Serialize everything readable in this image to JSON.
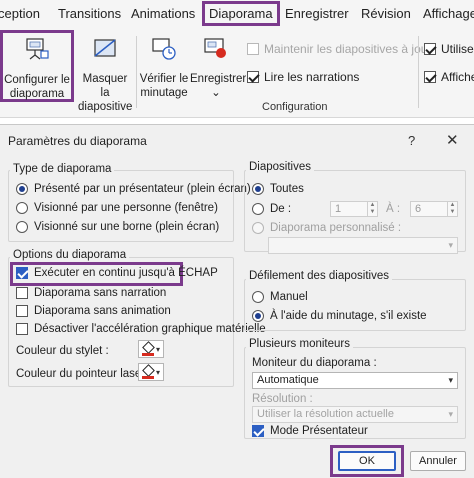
{
  "ribbon": {
    "tabs": [
      "ception",
      "Transitions",
      "Animations",
      "Diaporama",
      "Enregistrer",
      "Révision",
      "Affichage"
    ],
    "active_tab": "Diaporama",
    "buttons": {
      "configure": [
        "Configurer le",
        "diaporama"
      ],
      "hide": [
        "Masquer la",
        "diapositive"
      ],
      "check": [
        "Vérifier le",
        "minutage"
      ],
      "record": [
        "Enregistrer",
        "⌄"
      ]
    },
    "checkboxes": {
      "keep_slides": "Maintenir les diapositives à jour",
      "play_narrations": "Lire les narrations",
      "use_timings": "Utiliser",
      "show_controls": "Affiche"
    },
    "group_label": "Configuration"
  },
  "dialog": {
    "title": "Paramètres du diaporama",
    "help": "?",
    "close": "✕",
    "show_type": {
      "label": "Type de diaporama",
      "options": [
        "Présenté par un présentateur (plein écran)",
        "Visionné par une personne (fenêtre)",
        "Visionné sur une borne (plein écran)"
      ]
    },
    "show_options": {
      "label": "Options du diaporama",
      "loop": "Exécuter en continu jusqu'à ÉCHAP",
      "no_narration": "Diaporama sans narration",
      "no_animation": "Diaporama sans animation",
      "no_hw_accel": "Désactiver l'accélération graphique matérielle",
      "pen_color": "Couleur du stylet :",
      "laser_color": "Couleur du pointeur laser :"
    },
    "slides": {
      "label": "Diapositives",
      "all": "Toutes",
      "from": "De :",
      "from_value": "1",
      "to": "À :",
      "to_value": "6",
      "custom": "Diaporama personnalisé :"
    },
    "advance": {
      "label": "Défilement des diapositives",
      "manual": "Manuel",
      "timings": "À l'aide du minutage, s'il existe"
    },
    "monitors": {
      "label": "Plusieurs moniteurs",
      "monitor_label": "Moniteur du diaporama :",
      "monitor_value": "Automatique",
      "resolution_label": "Résolution :",
      "resolution_value": "Utiliser la résolution actuelle",
      "presenter_view": "Mode Présentateur"
    },
    "ok": "OK",
    "cancel": "Annuler"
  },
  "colors": {
    "highlight": "#7b3a8c",
    "accent": "#2c5fc3",
    "pen_red": "#d62b1f"
  }
}
